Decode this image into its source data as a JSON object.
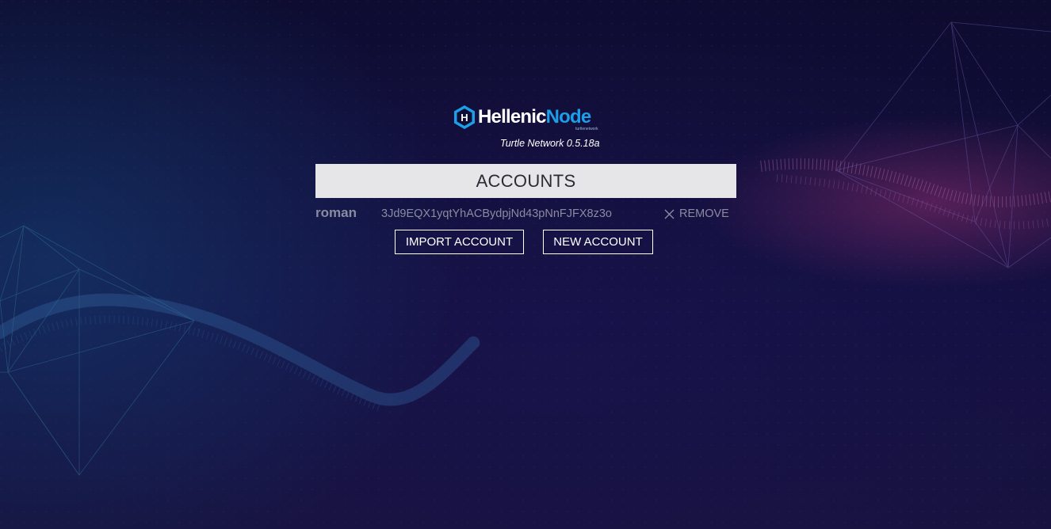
{
  "brand": {
    "name_part1": "Hellenic",
    "name_part2": "Node",
    "subtitle": "turtlenetwork",
    "hex_letter": "H",
    "colors": {
      "primary_blue": "#1d9ee8",
      "white": "#ffffff"
    }
  },
  "version_label": "Turtle Network 0.5.18a",
  "accounts": {
    "title": "ACCOUNTS",
    "items": [
      {
        "name": "roman",
        "address": "3Jd9EQX1yqtYhACBydpjNd43pNnFJFX8z3o",
        "remove_label": "REMOVE",
        "remove_icon": "close-icon"
      }
    ]
  },
  "actions": {
    "import_label": "IMPORT ACCOUNT",
    "new_label": "NEW ACCOUNT"
  },
  "theme": {
    "background": "#0f0d33",
    "header_bg": "#e6e6e9",
    "muted_text": "#8a8ba0"
  }
}
